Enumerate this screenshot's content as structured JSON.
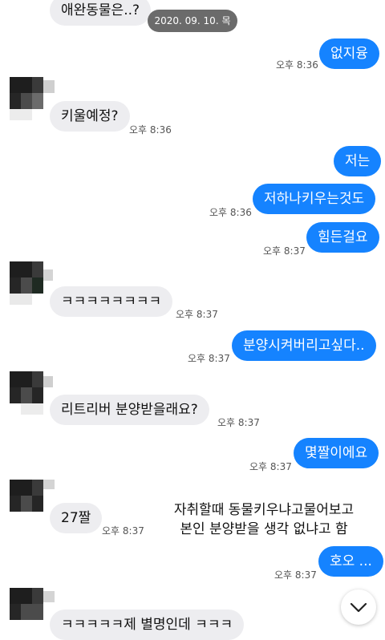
{
  "date_pill": "2020. 09. 10. 목",
  "messages": [
    {
      "text": "애완동물은..?",
      "time": ""
    },
    {
      "text": "없지융",
      "time": "오후 8:36"
    },
    {
      "text": "키울예정?",
      "time": "오후 8:36"
    },
    {
      "text": "저는",
      "time": ""
    },
    {
      "text": "저하나키우는것도",
      "time": "오후 8:36"
    },
    {
      "text": "힘든걸요",
      "time": "오후 8:37"
    },
    {
      "text": "ㅋㅋㅋㅋㅋㅋㅋㅋ",
      "time": "오후 8:37"
    },
    {
      "text": "분양시켜버리고싶다..",
      "time": "오후 8:37"
    },
    {
      "text": "리트리버 분양받을래요?",
      "time": "오후 8:37"
    },
    {
      "text": "몇짤이에요",
      "time": "오후 8:37"
    },
    {
      "text": "27짤",
      "time": "오후 8:37"
    },
    {
      "text": "호오 ...",
      "time": "오후 8:37"
    },
    {
      "text": "ㅋㅋㅋㅋㅋ제 별명인데 ㅋㅋㅋ",
      "time": ""
    }
  ],
  "caption": {
    "line1": "자취할때 동물키우냐고물어보고",
    "line2": "본인 분양받을 생각 없냐고 함"
  },
  "scroll_button_icon": "chevron-down-icon",
  "colors": {
    "outgoing": "#1583ff",
    "incoming": "#ededf0"
  }
}
